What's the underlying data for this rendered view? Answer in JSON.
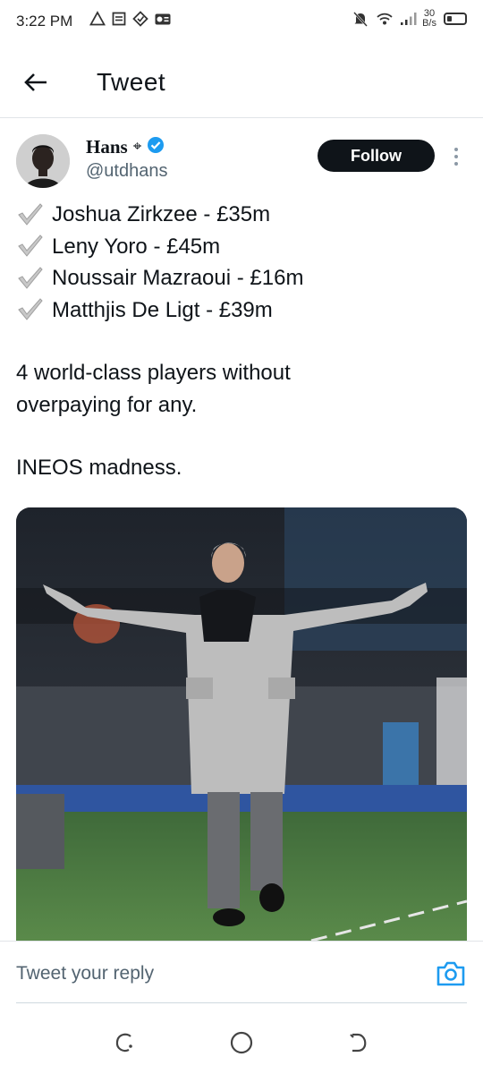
{
  "status_bar": {
    "time": "3:22 PM",
    "left_icons": [
      "warning-icon",
      "notes-icon",
      "vpn-icon",
      "radio-icon"
    ],
    "data_rate_value": "30",
    "data_rate_unit": "B/s",
    "right_icons": [
      "mute-icon",
      "wifi-icon",
      "signal-icon",
      "battery-icon"
    ]
  },
  "header": {
    "title": "Tweet",
    "back_icon": "arrow-left-icon"
  },
  "tweet": {
    "author": {
      "display_name": "Hans",
      "name_symbol": "⌖",
      "verified": true,
      "handle": "@utdhans"
    },
    "follow_label": "Follow",
    "lines": [
      "Joshua Zirkzee - £35m",
      "Leny Yoro - £45m",
      "Noussair Mazraoui - £16m",
      "Matthjis De Ligt - £39m"
    ],
    "paragraph_1_line_1": "4 world-class players without",
    "paragraph_1_line_2": "overpaying for any.",
    "paragraph_2": "INEOS madness.",
    "accent_color": "#1d9bf0"
  },
  "reply": {
    "placeholder": "Tweet your reply",
    "camera_icon": "camera-icon"
  },
  "nav_bar": {
    "buttons": [
      "recents-icon",
      "home-icon",
      "back-icon"
    ]
  }
}
